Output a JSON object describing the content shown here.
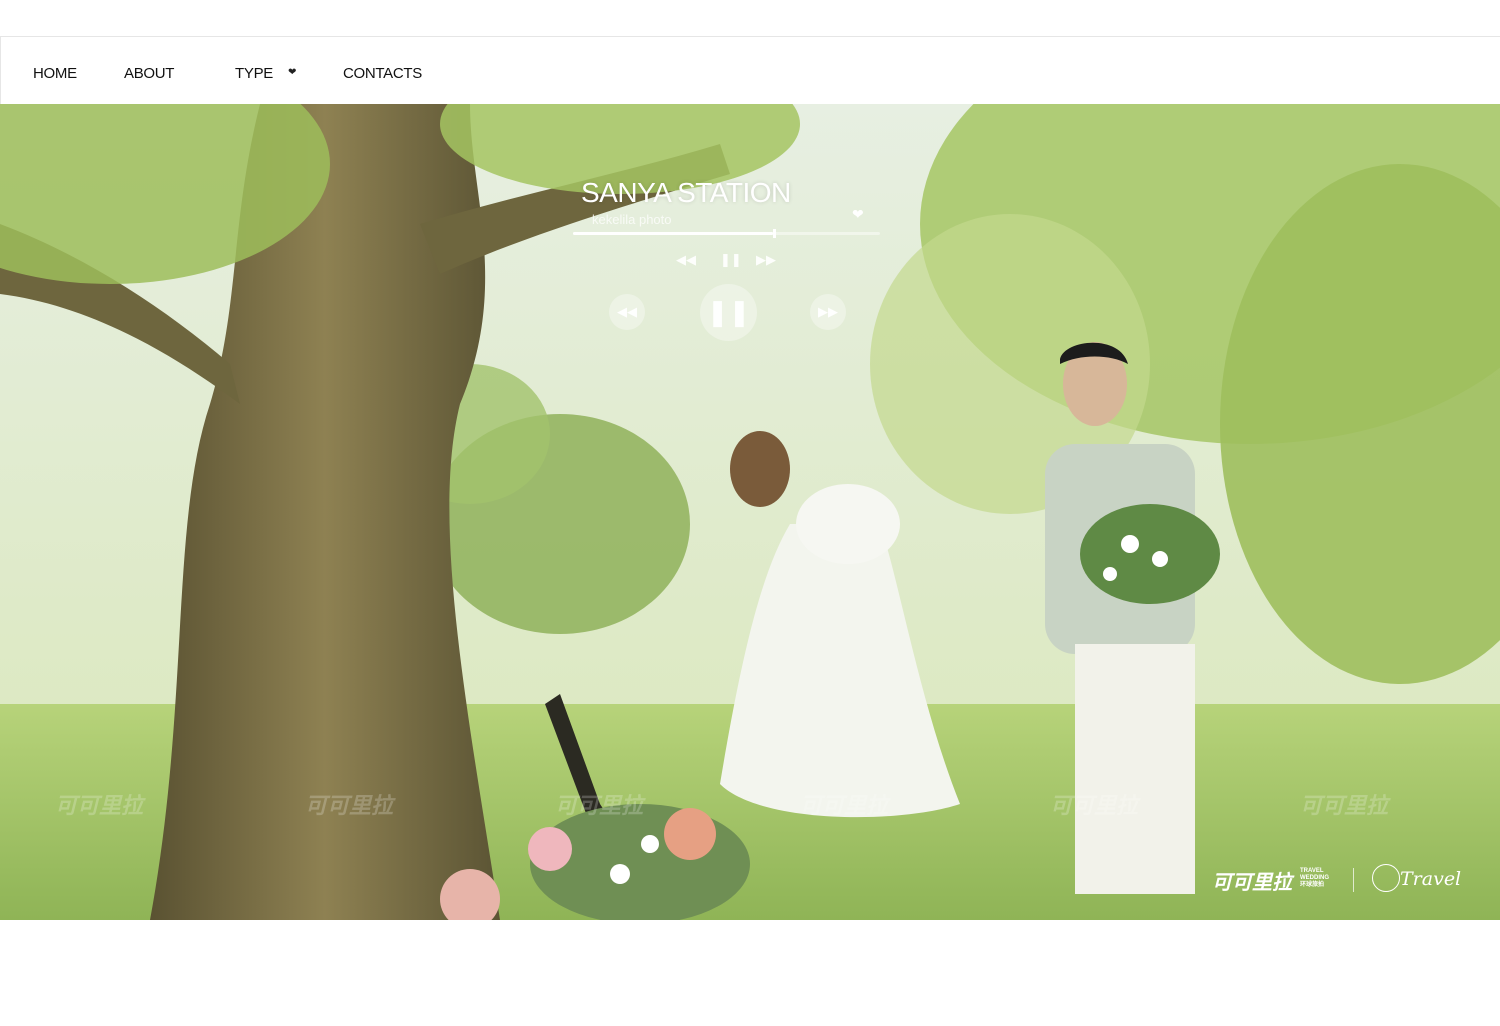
{
  "nav": {
    "items": [
      {
        "label": "HOME"
      },
      {
        "label": "ABOUT"
      },
      {
        "label": "TYPE"
      },
      {
        "label": "CONTACTS"
      }
    ]
  },
  "player": {
    "title": "SANYA STATION",
    "subtitle": "kekelila photo",
    "progress_fraction": 0.65
  },
  "watermark": {
    "text": "可可里拉"
  },
  "brand": {
    "logo_cn": "可可里拉",
    "logo_en_line1": "TRAVEL",
    "logo_en_line2": "WEDDING",
    "logo_cn_small": "环球旅拍",
    "travel": "Travel"
  },
  "colors": {
    "accent": "#ffffff",
    "foliage": "#9cbc62"
  }
}
